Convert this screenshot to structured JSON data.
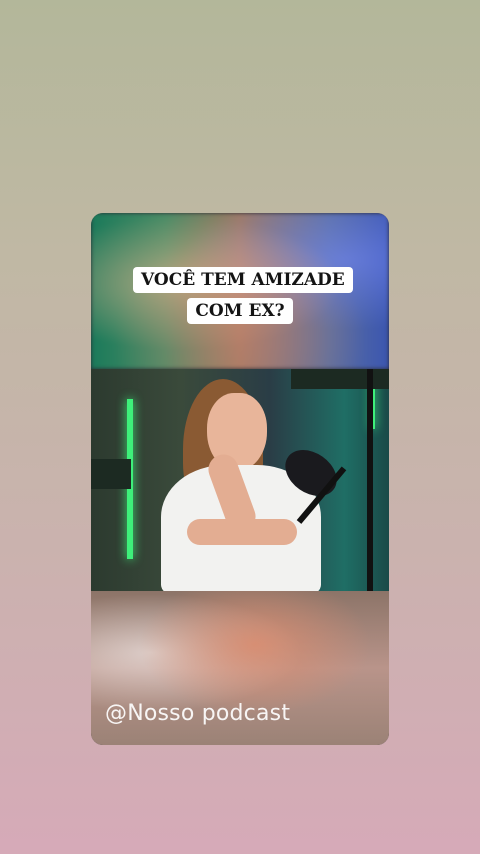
{
  "post": {
    "caption": "VOCÊ TEM AMIZADE COM EX?",
    "watermark": "@Nosso podcast"
  }
}
